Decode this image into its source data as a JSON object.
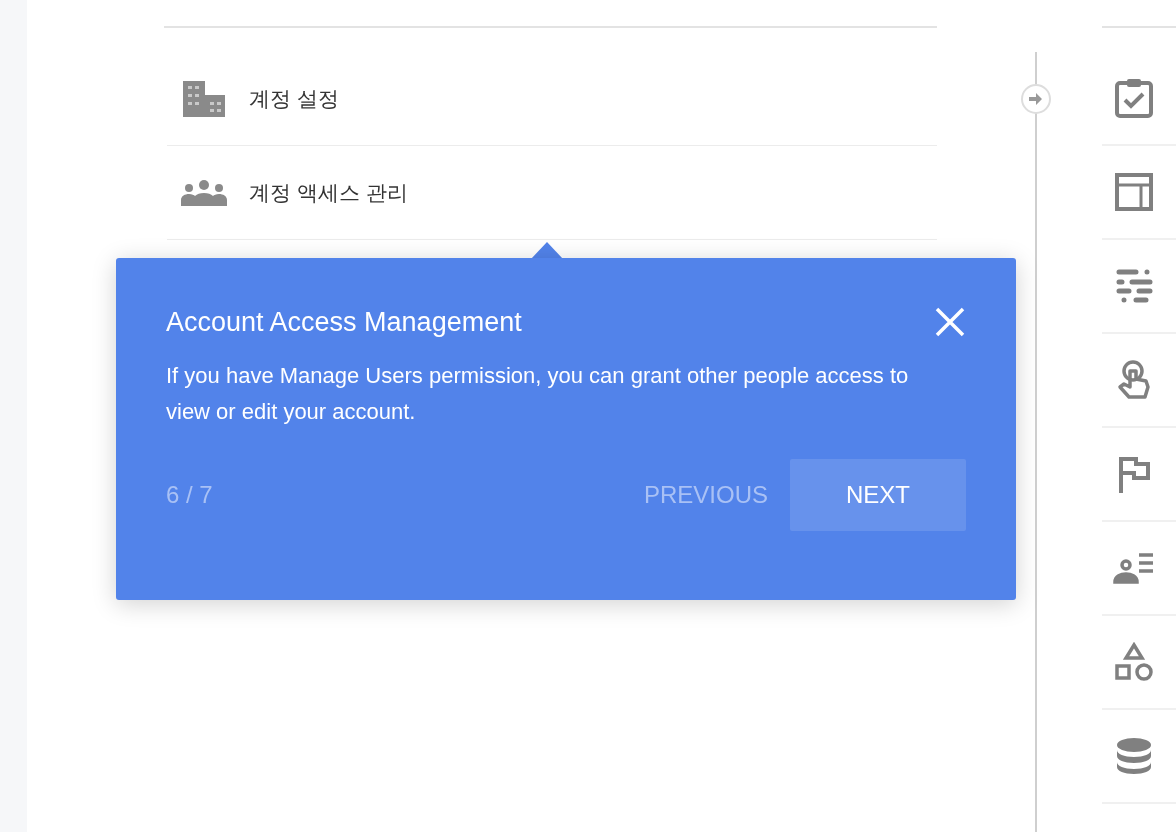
{
  "menu_items": [
    {
      "label": "계정 설정"
    },
    {
      "label": "계정 액세스 관리"
    }
  ],
  "tour_popover": {
    "title": "Account Access Management",
    "body": "If you have Manage Users permission, you can grant other people access to view or edit your account.",
    "step": "6 / 7",
    "previous_label": "PREVIOUS",
    "next_label": "NEXT"
  }
}
